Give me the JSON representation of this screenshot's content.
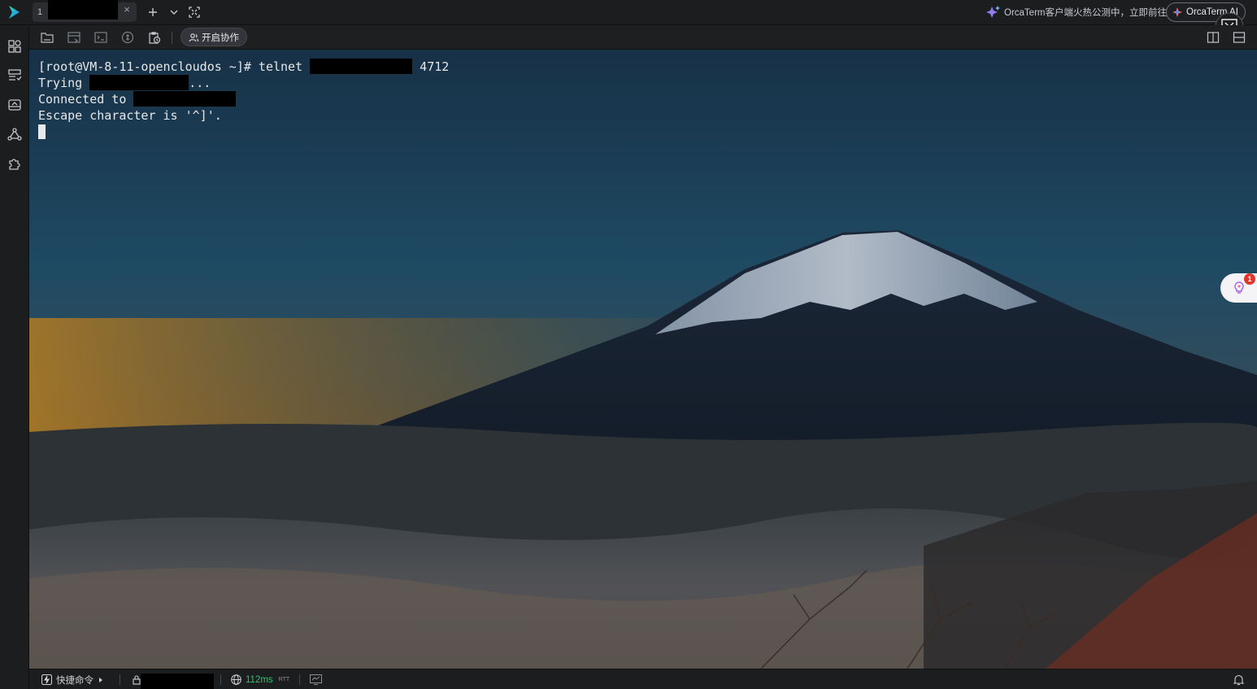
{
  "tabs": [
    {
      "number": "1",
      "title": "",
      "close": "×"
    }
  ],
  "topbar": {
    "promo_text": "OrcaTerm客户端火热公测中，立即前往",
    "ai_button": "OrcaTerm AI"
  },
  "toolbar": {
    "collab_label": "开启协作"
  },
  "terminal": {
    "prompt": "[root@VM-8-11-opencloudos ~]# telnet ",
    "port": " 4712",
    "line2_prefix": "Trying ",
    "line2_suffix": "...",
    "line3_prefix": "Connected to ",
    "line4": "Escape character is '^]'."
  },
  "notification_badge": "1",
  "statusbar": {
    "quick_commands": "快捷命令",
    "latency": "112ms",
    "latency_unit": "RTT"
  },
  "colors": {
    "accent_green": "#35c06e",
    "badge_red": "#e2352b",
    "brand_blue": "#3b6ed6"
  }
}
